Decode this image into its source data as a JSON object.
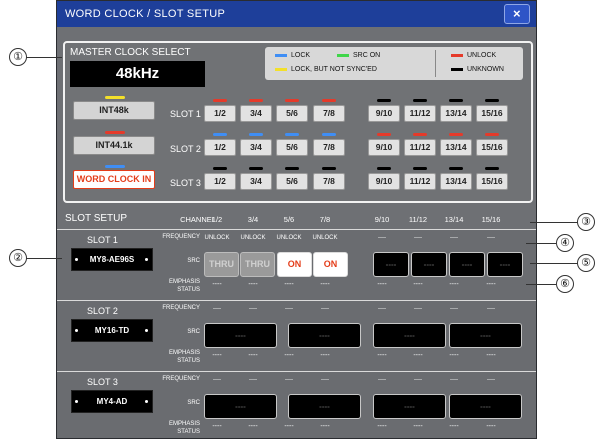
{
  "title": "WORD CLOCK / SLOT SETUP",
  "close_label": "×",
  "callouts": [
    "①",
    "②",
    "③",
    "④",
    "⑤",
    "⑥"
  ],
  "master_clock": {
    "title": "MASTER CLOCK SELECT",
    "value": "48kHz",
    "legend": [
      {
        "label": "LOCK",
        "color": "#3f8ef5"
      },
      {
        "label": "SRC ON",
        "color": "#3fd64a"
      },
      {
        "label": "UNLOCK",
        "color": "#e53a2a"
      },
      {
        "label": "LOCK, BUT NOT SYNC'ED",
        "color": "#f3e02a"
      },
      {
        "label": "UNKNOWN",
        "color": "#000000"
      }
    ],
    "sources": [
      {
        "label": "INT48k",
        "indicator": "#f3e02a",
        "active": false
      },
      {
        "label": "INT44.1k",
        "indicator": "#e53a2a",
        "active": false
      },
      {
        "label": "WORD CLOCK IN",
        "indicator": "#3f8ef5",
        "active": true
      }
    ],
    "slots": [
      {
        "label": "SLOT 1",
        "channels": [
          "1/2",
          "3/4",
          "5/6",
          "7/8",
          "9/10",
          "11/12",
          "13/14",
          "15/16"
        ],
        "indicators": [
          "#e53a2a",
          "#e53a2a",
          "#e53a2a",
          "#e53a2a",
          "#000000",
          "#000000",
          "#000000",
          "#000000"
        ]
      },
      {
        "label": "SLOT 2",
        "channels": [
          "1/2",
          "3/4",
          "5/6",
          "7/8",
          "9/10",
          "11/12",
          "13/14",
          "15/16"
        ],
        "indicators": [
          "#3f8ef5",
          "#3f8ef5",
          "#3f8ef5",
          "#3f8ef5",
          "#e53a2a",
          "#e53a2a",
          "#e53a2a",
          "#e53a2a"
        ]
      },
      {
        "label": "SLOT 3",
        "channels": [
          "1/2",
          "3/4",
          "5/6",
          "7/8",
          "9/10",
          "11/12",
          "13/14",
          "15/16"
        ],
        "indicators": [
          "#000000",
          "#000000",
          "#000000",
          "#000000",
          "#000000",
          "#000000",
          "#000000",
          "#000000"
        ]
      }
    ]
  },
  "slot_setup": {
    "title": "SLOT SETUP",
    "channel_label": "CHANNEL",
    "channels": [
      "1/2",
      "3/4",
      "5/6",
      "7/8",
      "9/10",
      "11/12",
      "13/14",
      "15/16"
    ],
    "row_labels": {
      "frequency": "FREQUENCY",
      "src": "SRC",
      "emphasis": "EMPHASIS",
      "status": "STATUS"
    },
    "slots": [
      {
        "name": "SLOT 1",
        "card": "MY8-AE96S",
        "frequency": [
          "UNLOCK",
          "UNLOCK",
          "UNLOCK",
          "UNLOCK",
          "----",
          "----",
          "----",
          "----"
        ],
        "src": [
          "THRU",
          "THRU",
          "ON",
          "ON",
          "----",
          "----",
          "----",
          "----"
        ],
        "emphasis": [
          "----",
          "----",
          "----",
          "----",
          "----",
          "----",
          "----",
          "----"
        ]
      },
      {
        "name": "SLOT 2",
        "card": "MY16-TD",
        "frequency": [
          "----",
          "----",
          "----",
          "----",
          "----",
          "----",
          "----",
          "----"
        ],
        "src": [
          "----",
          "----",
          "----",
          "----"
        ],
        "emphasis": [
          "----",
          "----",
          "----",
          "----",
          "----",
          "----",
          "----",
          "----"
        ]
      },
      {
        "name": "SLOT 3",
        "card": "MY4-AD",
        "frequency": [
          "----",
          "----",
          "----",
          "----",
          "----",
          "----",
          "----",
          "----"
        ],
        "src": [
          "----",
          "----",
          "----",
          "----"
        ],
        "emphasis": [
          "----",
          "----",
          "----",
          "----",
          "----",
          "----",
          "----",
          "----"
        ]
      }
    ]
  }
}
